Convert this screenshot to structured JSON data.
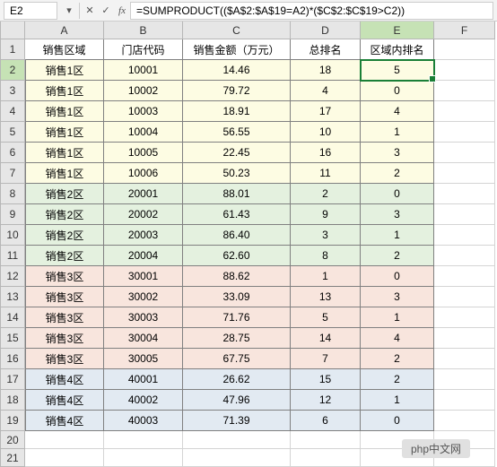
{
  "formula_bar": {
    "name_box": "E2",
    "cancel": "✕",
    "enter": "✓",
    "fx": "fx",
    "formula": "=SUMPRODUCT(($A$2:$A$19=A2)*($C$2:$C$19>C2))"
  },
  "columns": [
    "A",
    "B",
    "C",
    "D",
    "E",
    "F"
  ],
  "headers": {
    "A": "销售区域",
    "B": "门店代码",
    "C": "销售金额（万元）",
    "D": "总排名",
    "E": "区域内排名"
  },
  "rows": [
    {
      "n": 2,
      "zone": "z1",
      "A": "销售1区",
      "B": "10001",
      "C": "14.46",
      "D": "18",
      "E": "5"
    },
    {
      "n": 3,
      "zone": "z1",
      "A": "销售1区",
      "B": "10002",
      "C": "79.72",
      "D": "4",
      "E": "0"
    },
    {
      "n": 4,
      "zone": "z1",
      "A": "销售1区",
      "B": "10003",
      "C": "18.91",
      "D": "17",
      "E": "4"
    },
    {
      "n": 5,
      "zone": "z1",
      "A": "销售1区",
      "B": "10004",
      "C": "56.55",
      "D": "10",
      "E": "1"
    },
    {
      "n": 6,
      "zone": "z1",
      "A": "销售1区",
      "B": "10005",
      "C": "22.45",
      "D": "16",
      "E": "3"
    },
    {
      "n": 7,
      "zone": "z1",
      "A": "销售1区",
      "B": "10006",
      "C": "50.23",
      "D": "11",
      "E": "2"
    },
    {
      "n": 8,
      "zone": "z2",
      "A": "销售2区",
      "B": "20001",
      "C": "88.01",
      "D": "2",
      "E": "0"
    },
    {
      "n": 9,
      "zone": "z2",
      "A": "销售2区",
      "B": "20002",
      "C": "61.43",
      "D": "9",
      "E": "3"
    },
    {
      "n": 10,
      "zone": "z2",
      "A": "销售2区",
      "B": "20003",
      "C": "86.40",
      "D": "3",
      "E": "1"
    },
    {
      "n": 11,
      "zone": "z2",
      "A": "销售2区",
      "B": "20004",
      "C": "62.60",
      "D": "8",
      "E": "2"
    },
    {
      "n": 12,
      "zone": "z3",
      "A": "销售3区",
      "B": "30001",
      "C": "88.62",
      "D": "1",
      "E": "0"
    },
    {
      "n": 13,
      "zone": "z3",
      "A": "销售3区",
      "B": "30002",
      "C": "33.09",
      "D": "13",
      "E": "3"
    },
    {
      "n": 14,
      "zone": "z3",
      "A": "销售3区",
      "B": "30003",
      "C": "71.76",
      "D": "5",
      "E": "1"
    },
    {
      "n": 15,
      "zone": "z3",
      "A": "销售3区",
      "B": "30004",
      "C": "28.75",
      "D": "14",
      "E": "4"
    },
    {
      "n": 16,
      "zone": "z3",
      "A": "销售3区",
      "B": "30005",
      "C": "67.75",
      "D": "7",
      "E": "2"
    },
    {
      "n": 17,
      "zone": "z4",
      "A": "销售4区",
      "B": "40001",
      "C": "26.62",
      "D": "15",
      "E": "2"
    },
    {
      "n": 18,
      "zone": "z4",
      "A": "销售4区",
      "B": "40002",
      "C": "47.96",
      "D": "12",
      "E": "1"
    },
    {
      "n": 19,
      "zone": "z4",
      "A": "销售4区",
      "B": "40003",
      "C": "71.39",
      "D": "6",
      "E": "0"
    }
  ],
  "empty_rows": [
    20,
    21
  ],
  "active_cell": "E2",
  "watermark": "php中文网"
}
